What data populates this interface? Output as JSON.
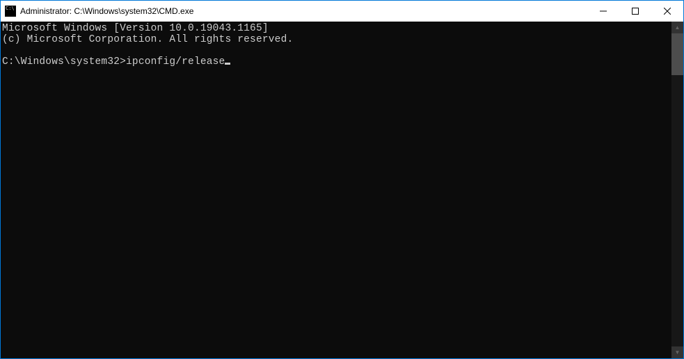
{
  "titlebar": {
    "title": "Administrator: C:\\Windows\\system32\\CMD.exe"
  },
  "terminal": {
    "line1": "Microsoft Windows [Version 10.0.19043.1165]",
    "line2": "(c) Microsoft Corporation. All rights reserved.",
    "blank": "",
    "prompt": "C:\\Windows\\system32>",
    "command": "ipconfig/release"
  }
}
